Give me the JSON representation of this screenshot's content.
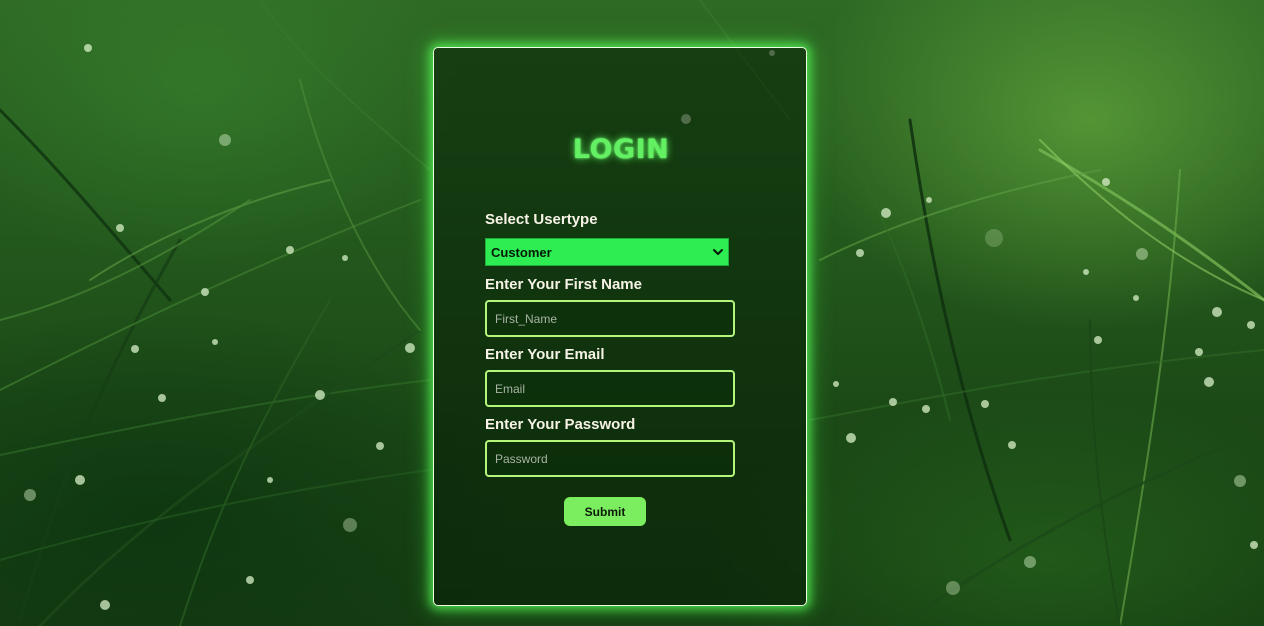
{
  "login": {
    "title": "LOGIN",
    "usertype": {
      "label": "Select Usertype",
      "selected": "Customer"
    },
    "first_name": {
      "label": "Enter Your First Name",
      "placeholder": "First_Name",
      "value": ""
    },
    "email": {
      "label": "Enter Your Email",
      "placeholder": "Email",
      "value": ""
    },
    "password": {
      "label": "Enter Your Password",
      "placeholder": "Password",
      "value": ""
    },
    "submit_label": "Submit"
  },
  "icons": {
    "dropdown": "chevron-down-icon"
  },
  "colors": {
    "title_glow": "#63f063",
    "select_bg": "#2ded52",
    "input_border": "#b4f57c",
    "button_bg": "#7aee5e",
    "card_glow": "#5aff5a"
  }
}
